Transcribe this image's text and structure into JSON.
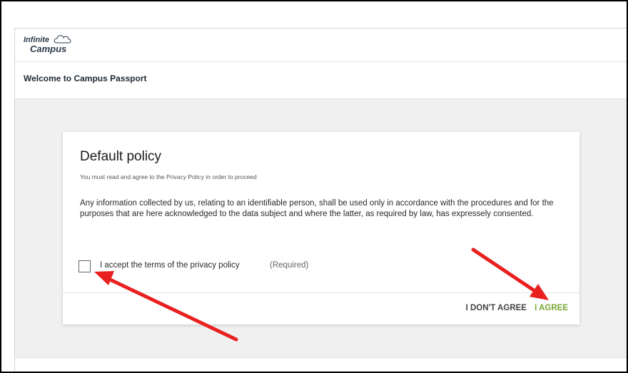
{
  "logo": {
    "line1": "Infinite",
    "line2": "Campus"
  },
  "header": {
    "title": "Welcome to Campus Passport"
  },
  "policy": {
    "title": "Default policy",
    "subtitle": "You must read and agree to the Privacy Policy in order to proceed",
    "body": "Any information collected by us, relating to an identifiable person, shall be used only in accordance with the procedures and for the purposes that are here acknowledged to the data subject and where the latter, as required by law, has expressely consented.",
    "accept_label": "I accept the terms of the privacy policy",
    "required_label": "(Required)",
    "checkbox_checked": false
  },
  "actions": {
    "disagree_label": "I DON'T AGREE",
    "agree_label": "I AGREE"
  },
  "colors": {
    "agree": "#7aa833",
    "annotation_arrow": "#e8201f"
  }
}
